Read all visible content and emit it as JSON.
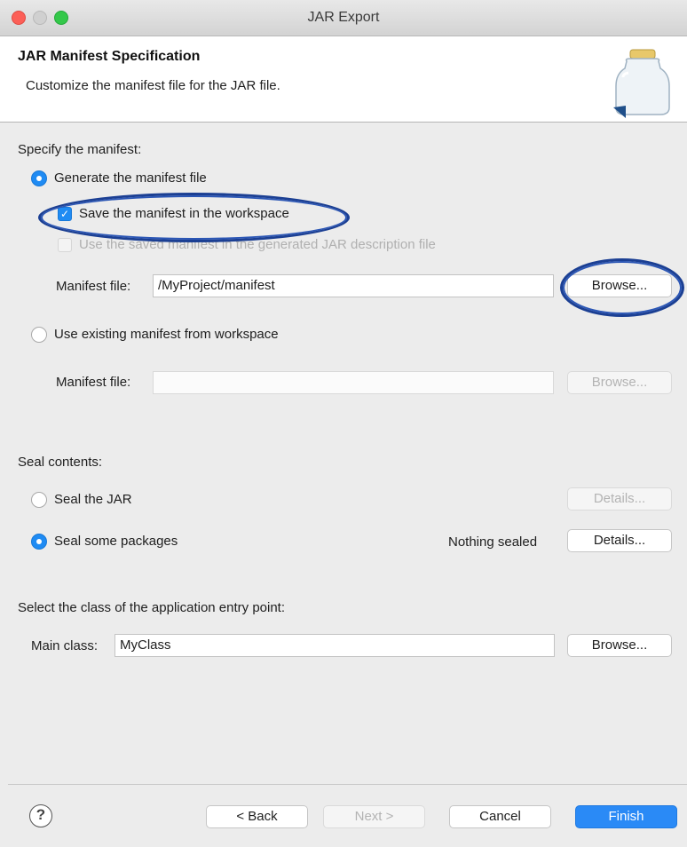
{
  "window": {
    "title": "JAR Export"
  },
  "banner": {
    "title": "JAR Manifest Specification",
    "description": "Customize the manifest file for the JAR file.",
    "icon": "jar-icon"
  },
  "manifest": {
    "heading": "Specify the manifest:",
    "generate_label": "Generate the manifest file",
    "generate_selected": true,
    "save_label": "Save the manifest in the workspace",
    "save_checked": true,
    "reuse_label": "Use the saved manifest in the generated JAR description file",
    "reuse_checked": false,
    "file_label": "Manifest file:",
    "file_value": "/MyProject/manifest",
    "browse_label": "Browse...",
    "existing_label": "Use existing manifest from workspace",
    "existing_selected": false,
    "existing_file_label": "Manifest file:",
    "existing_file_value": "",
    "existing_browse_label": "Browse..."
  },
  "seal": {
    "heading": "Seal contents:",
    "seal_jar_label": "Seal the JAR",
    "seal_jar_selected": false,
    "seal_jar_details": "Details...",
    "seal_some_label": "Seal some packages",
    "seal_some_selected": true,
    "status": "Nothing sealed",
    "seal_some_details": "Details..."
  },
  "entry": {
    "heading": "Select the class of the application entry point:",
    "main_class_label": "Main class:",
    "main_class_value": "MyClass",
    "browse_label": "Browse..."
  },
  "footer": {
    "help": "?",
    "back": "< Back",
    "next": "Next >",
    "cancel": "Cancel",
    "finish": "Finish"
  },
  "colors": {
    "accent": "#1f8bf3",
    "annotation": "#1b3f93"
  }
}
